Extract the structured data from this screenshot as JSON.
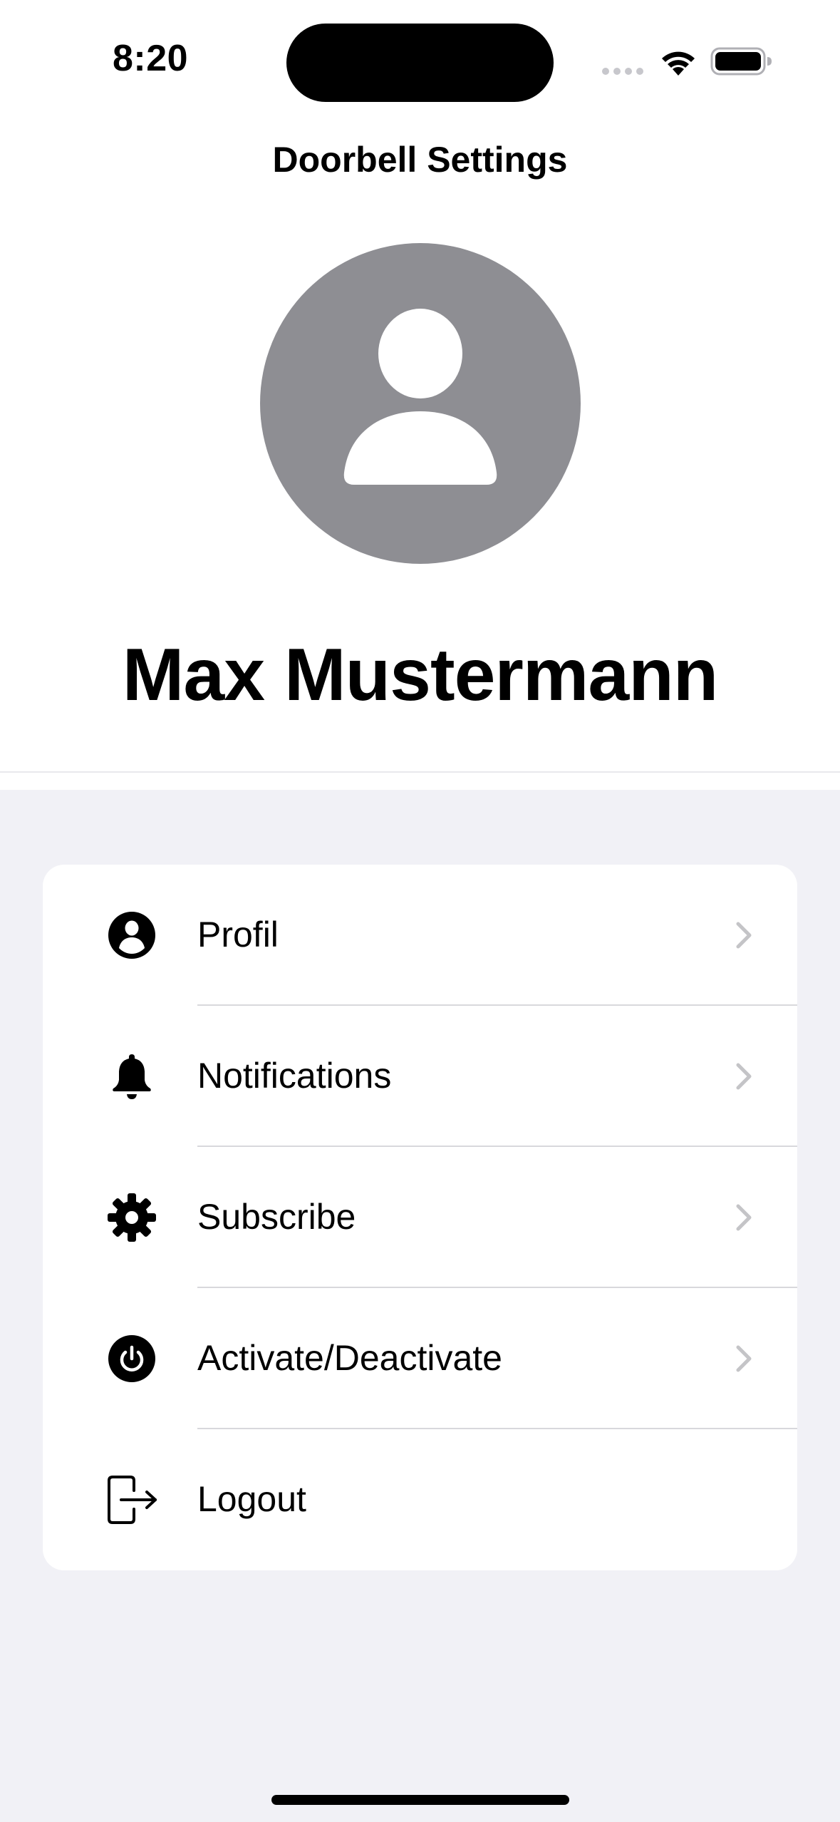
{
  "status_bar": {
    "time": "8:20",
    "icons": [
      "cellular-dots-icon",
      "wifi-icon",
      "battery-icon"
    ]
  },
  "header": {
    "title": "Doorbell Settings",
    "avatar_icon": "person-circle-icon",
    "user_name": "Max Mustermann"
  },
  "menu": {
    "items": [
      {
        "label": "Profil",
        "icon": "person-circle-icon",
        "chevron": true
      },
      {
        "label": "Notifications",
        "icon": "bell-icon",
        "chevron": true
      },
      {
        "label": "Subscribe",
        "icon": "gear-icon",
        "chevron": true
      },
      {
        "label": "Activate/Deactivate",
        "icon": "power-icon",
        "chevron": true
      },
      {
        "label": "Logout",
        "icon": "logout-icon",
        "chevron": false
      }
    ]
  },
  "colors": {
    "avatar_gray": "#8e8e93",
    "grouped_background": "#f1f1f6",
    "chevron": "#c4c4c7",
    "separator": "#d8d8dc"
  }
}
